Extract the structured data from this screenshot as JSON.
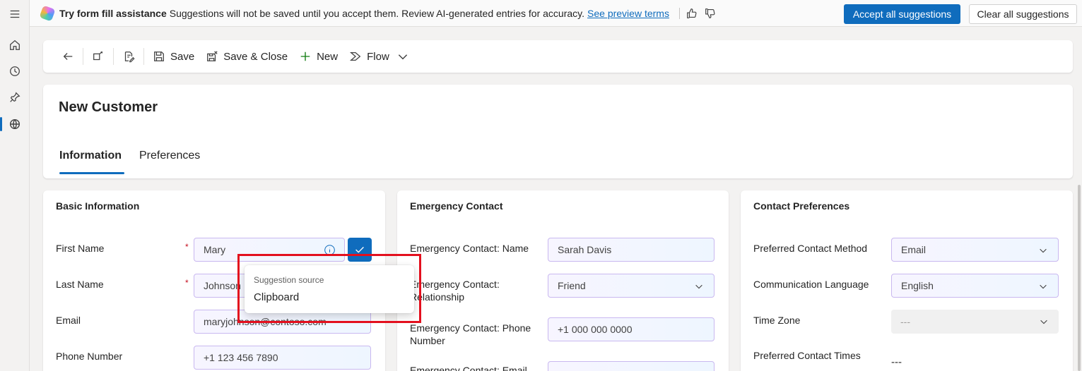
{
  "assist": {
    "title": "Try form fill assistance",
    "message": "Suggestions will not be saved until you accept them. Review AI-generated entries for accuracy.",
    "link": "See preview terms",
    "accept_label": "Accept all suggestions",
    "clear_label": "Clear all suggestions"
  },
  "toolbar": {
    "save_label": "Save",
    "save_close_label": "Save & Close",
    "new_label": "New",
    "flow_label": "Flow"
  },
  "header": {
    "title": "New Customer",
    "tabs": [
      {
        "label": "Information"
      },
      {
        "label": "Preferences"
      }
    ]
  },
  "basic": {
    "title": "Basic Information",
    "first_name": {
      "label": "First Name",
      "value": "Mary"
    },
    "last_name": {
      "label": "Last Name",
      "value": "Johnson"
    },
    "email": {
      "label": "Email",
      "value": "maryjohnson@contoso.com"
    },
    "phone": {
      "label": "Phone Number",
      "value": "+1 123 456 7890"
    }
  },
  "emergency": {
    "title": "Emergency Contact",
    "name": {
      "label": "Emergency Contact: Name",
      "value": "Sarah Davis"
    },
    "relationship": {
      "label_line1": "Emergency Contact:",
      "label_line2": "Relationship",
      "value": "Friend"
    },
    "phone": {
      "label_line1": "Emergency Contact: Phone",
      "label_line2": "Number",
      "value": "+1 000 000 0000"
    },
    "email": {
      "label": "Emergency Contact: Email"
    }
  },
  "prefs": {
    "title": "Contact Preferences",
    "method": {
      "label": "Preferred Contact Method",
      "value": "Email"
    },
    "language": {
      "label": "Communication Language",
      "value": "English"
    },
    "timezone": {
      "label": "Time Zone",
      "value": "---"
    },
    "times": {
      "label": "Preferred Contact Times",
      "value": "---"
    }
  },
  "popup": {
    "caption": "Suggestion source",
    "value": "Clipboard"
  }
}
